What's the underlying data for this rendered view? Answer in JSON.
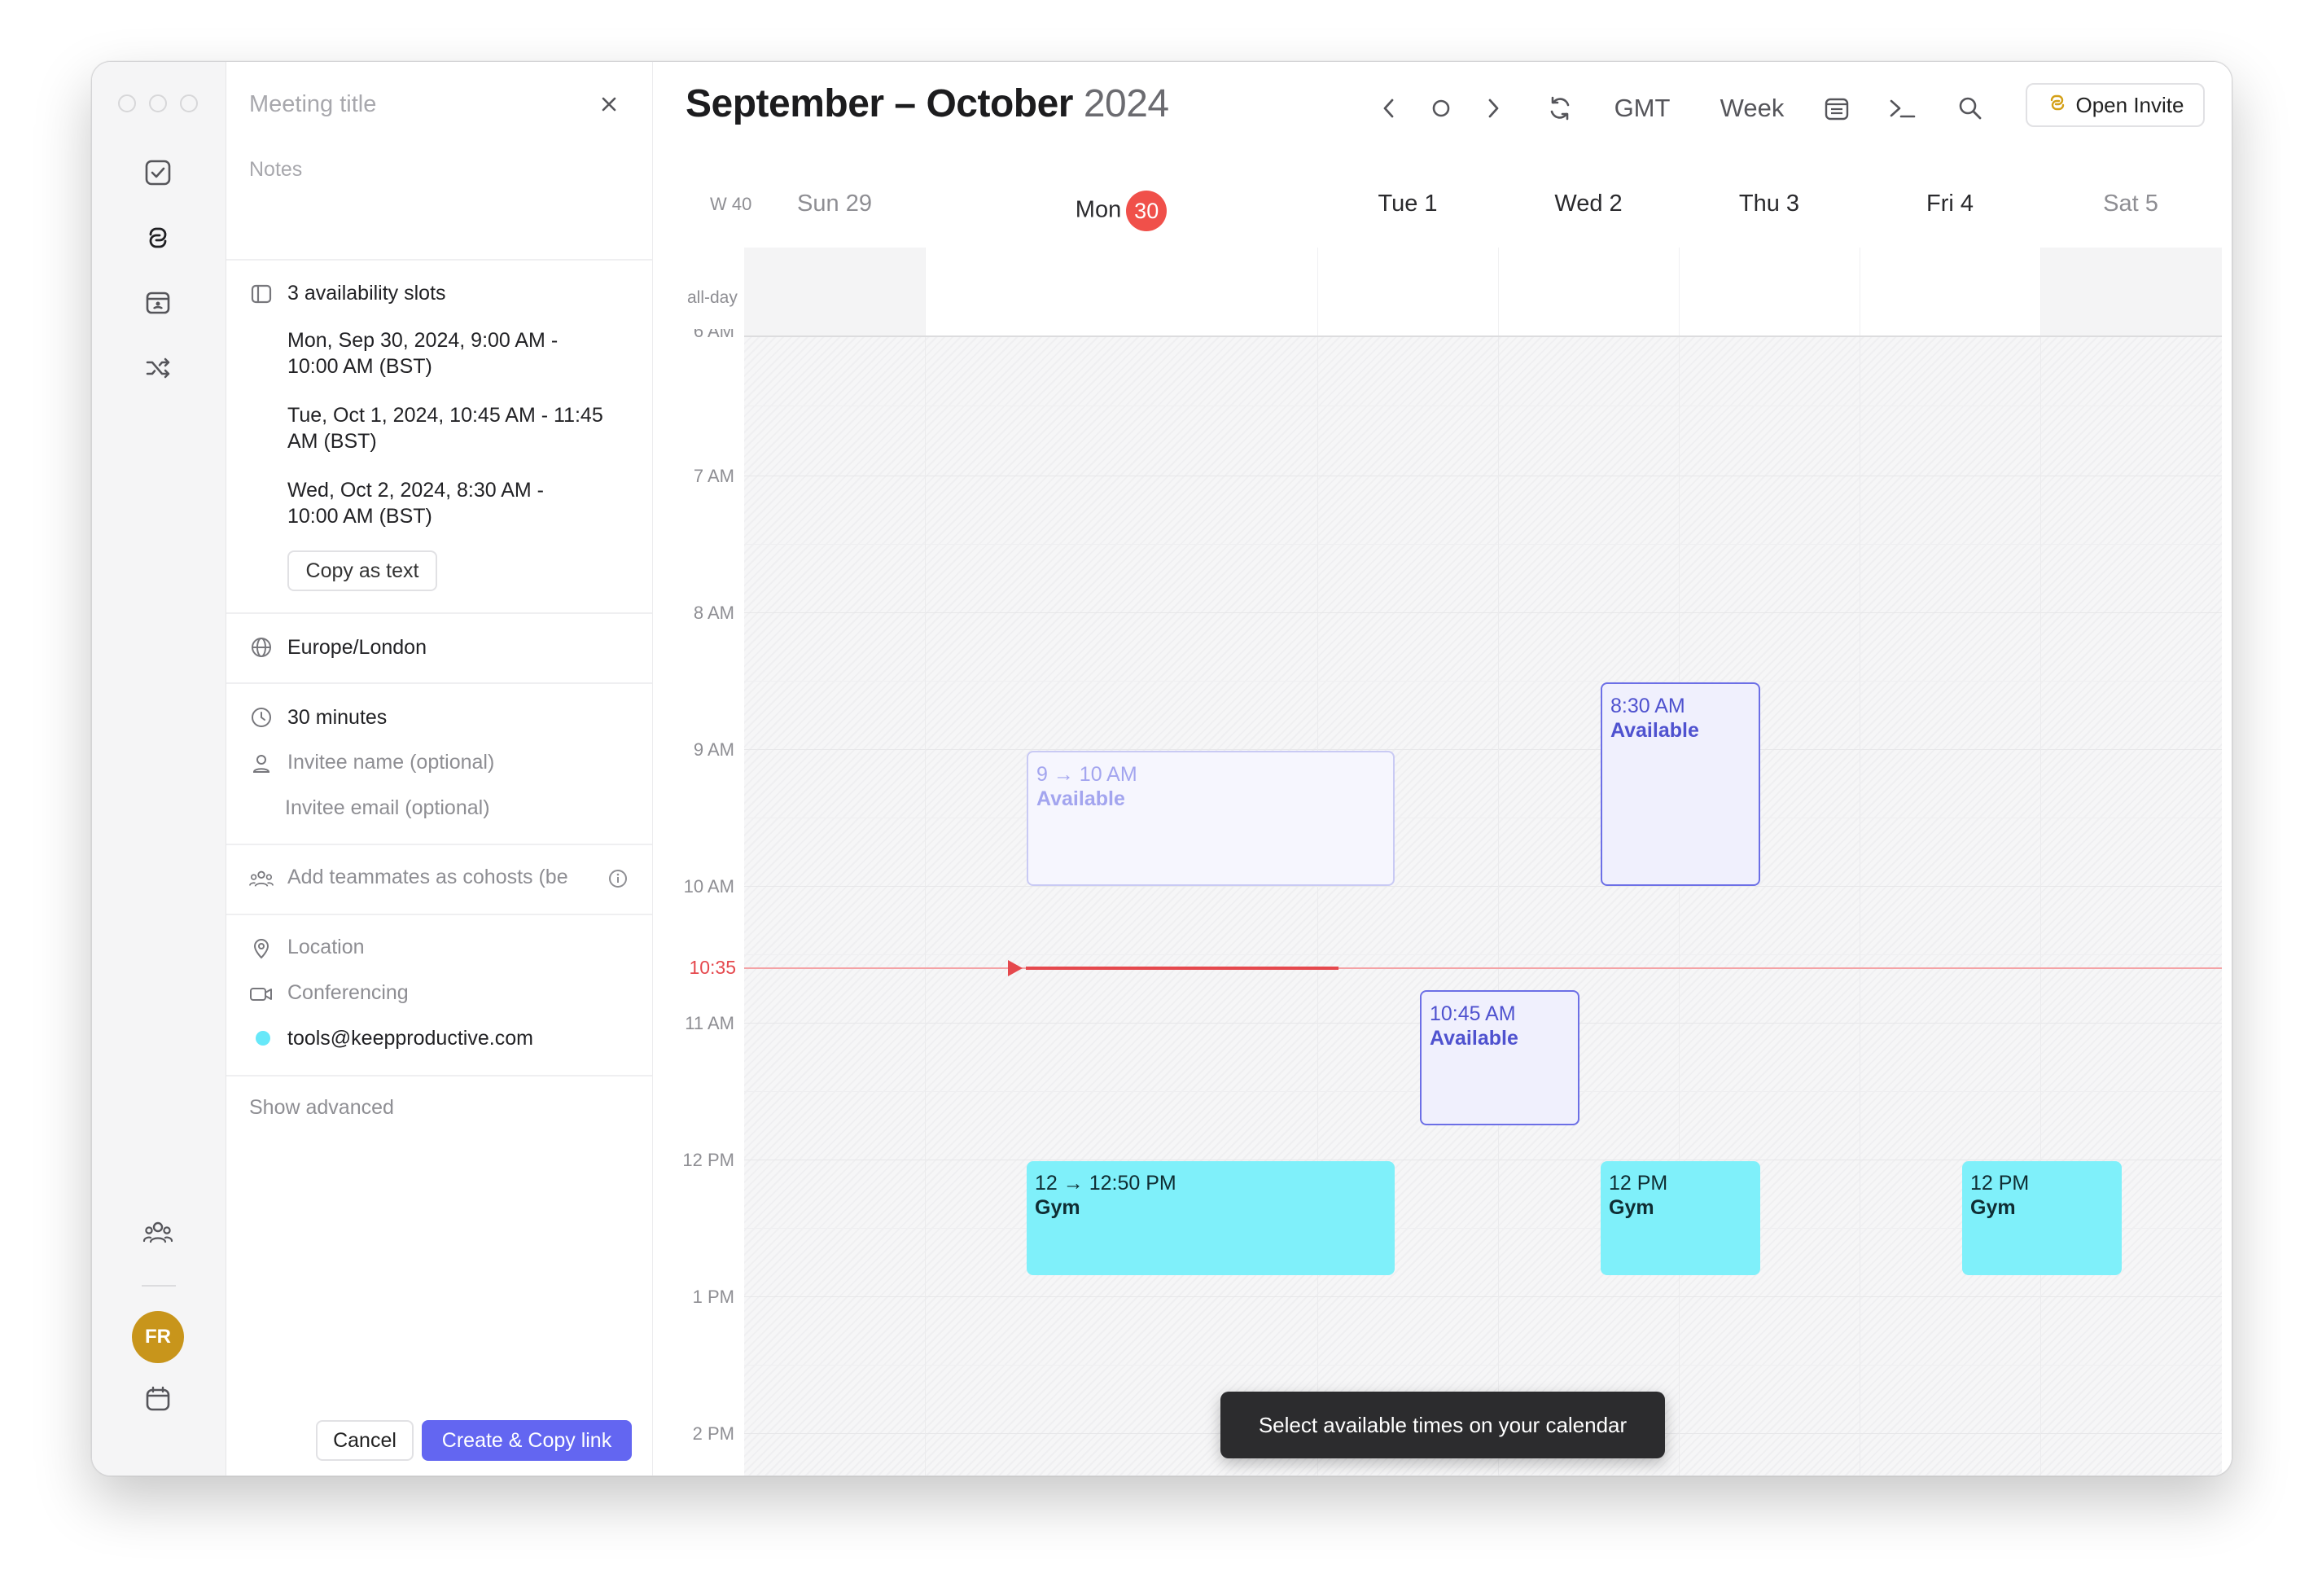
{
  "panel": {
    "title_placeholder": "Meeting title",
    "notes_placeholder": "Notes",
    "slots_header": "3 availability slots",
    "slots": [
      {
        "line1": "Mon, Sep 30, 2024, 9:00 AM -",
        "line2": "10:00 AM (BST)"
      },
      {
        "line1": "Tue, Oct 1, 2024, 10:45 AM - 11:45",
        "line2": "AM (BST)"
      },
      {
        "line1": "Wed, Oct 2, 2024, 8:30 AM -",
        "line2": "10:00 AM (BST)"
      }
    ],
    "copy_label": "Copy as text",
    "timezone": "Europe/London",
    "duration": "30 minutes",
    "invitee_name_placeholder": "Invitee name (optional)",
    "invitee_email_placeholder": "Invitee email (optional)",
    "cohosts_placeholder": "Add teammates as cohosts (be",
    "location_placeholder": "Location",
    "conferencing_placeholder": "Conferencing",
    "calendar_account": "tools@keepproductive.com",
    "show_advanced": "Show advanced",
    "cancel_label": "Cancel",
    "create_label": "Create & Copy link"
  },
  "rail": {
    "avatar_initials": "FR"
  },
  "calendar": {
    "title_months": "September – October",
    "title_year": "2024",
    "timezone_label": "GMT",
    "view_label": "Week",
    "open_invite_label": "Open Invite",
    "week_label": "W 40",
    "days": [
      {
        "label": "Sun 29"
      },
      {
        "label": "Mon",
        "badge": "30"
      },
      {
        "label": "Tue 1"
      },
      {
        "label": "Wed 2"
      },
      {
        "label": "Thu 3"
      },
      {
        "label": "Fri 4"
      },
      {
        "label": "Sat 5"
      }
    ],
    "allday_label": "all-day",
    "hours": [
      "7 AM",
      "8 AM",
      "9 AM",
      "10 AM",
      "11 AM",
      "12 PM",
      "1 PM",
      "2 PM"
    ],
    "now_label": "10:35",
    "events": [
      {
        "time": "9 → 10 AM",
        "name": "Available"
      },
      {
        "time": "8:30 AM",
        "name": "Available"
      },
      {
        "time": "10:45 AM",
        "name": "Available"
      },
      {
        "time": "12 → 12:50 PM",
        "name": "Gym"
      },
      {
        "time": "12 PM",
        "name": "Gym"
      },
      {
        "time": "12 PM",
        "name": "Gym"
      }
    ],
    "toast": "Select available times on your calendar"
  },
  "colors": {
    "accent": "#6366f1",
    "today": "#f0504a",
    "gym": "#7ff0fa",
    "avatar": "#c8951b"
  }
}
